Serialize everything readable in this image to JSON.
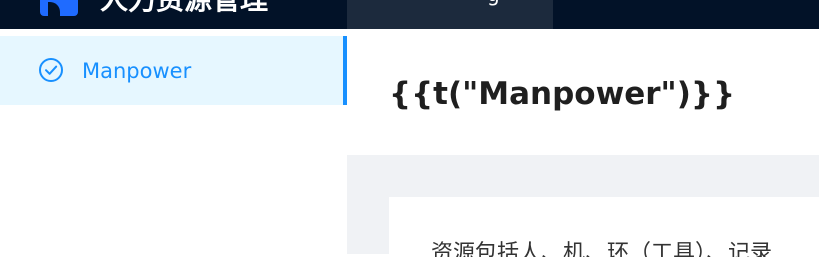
{
  "header": {
    "app_title": "人力资源管理",
    "tab_label": "g",
    "colors": {
      "background": "#021228",
      "active_tab": "#1c2a3d",
      "logo": "#1f6bff"
    }
  },
  "sidebar": {
    "items": [
      {
        "label": "Manpower",
        "icon": "check-circle-icon",
        "active": true
      }
    ],
    "colors": {
      "active_bg": "#e6f7ff",
      "accent": "#1890ff"
    }
  },
  "main": {
    "title": "{{t(\"Manpower\")}}",
    "card": {
      "text": "资源包括人、机、环（工具）、记录"
    },
    "colors": {
      "content_bg": "#f0f2f5"
    }
  }
}
